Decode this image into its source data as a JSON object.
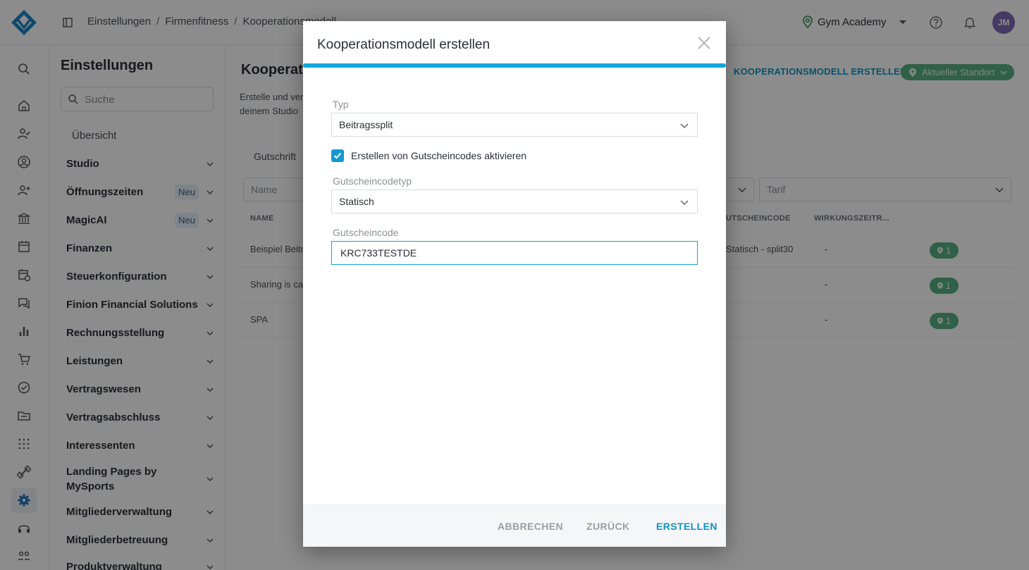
{
  "topbar": {
    "breadcrumb": [
      "Einstellungen",
      "Firmenfitness",
      "Kooperationsmodell"
    ],
    "breadcrumb_sep": "/",
    "studio": "Gym Academy",
    "avatar_initials": "JM"
  },
  "rail": {
    "icons": [
      "search-icon",
      "home-icon",
      "user-check-icon",
      "user-circle-icon",
      "user-add-icon",
      "bank-icon",
      "calendar-icon",
      "calendar-clock-icon",
      "chat-icon",
      "bar-chart-icon",
      "cart-icon",
      "check-circle-icon",
      "folder-icon",
      "dots-grid-icon",
      "dumbbell-icon",
      "gear-icon",
      "headset-icon",
      "people-icon"
    ],
    "active": "gear-icon"
  },
  "settings": {
    "title": "Einstellungen",
    "search_placeholder": "Suche",
    "overview": "Übersicht",
    "items": [
      {
        "label": "Studio",
        "badge": ""
      },
      {
        "label": "Öffnungszeiten",
        "badge": "Neu"
      },
      {
        "label": "MagicAI",
        "badge": "Neu"
      },
      {
        "label": "Finanzen",
        "badge": ""
      },
      {
        "label": "Steuerkonfiguration",
        "badge": ""
      },
      {
        "label": "Finion Financial Solutions",
        "badge": ""
      },
      {
        "label": "Rechnungsstellung",
        "badge": ""
      },
      {
        "label": "Leistungen",
        "badge": ""
      },
      {
        "label": "Vertragswesen",
        "badge": ""
      },
      {
        "label": "Vertragsabschluss",
        "badge": ""
      },
      {
        "label": "Interessenten",
        "badge": ""
      },
      {
        "label": "Landing Pages by MySports",
        "badge": ""
      },
      {
        "label": "Mitgliederverwaltung",
        "badge": ""
      },
      {
        "label": "Mitgliederbetreuung",
        "badge": ""
      },
      {
        "label": "Produktverwaltung",
        "badge": ""
      }
    ]
  },
  "main": {
    "title": "Kooperat",
    "description": "Erstelle und ver\ndeinem Studio",
    "create_label": "KOOPERATIONSMODELL ERSTELLEN",
    "location_label": "Aktueller Standort",
    "tab": "Gutschrift",
    "filter_name_placeholder": "Name",
    "filter_tarif_placeholder": "Tarif",
    "columns": {
      "name": "NAME",
      "code": "UTSCHEINCODE",
      "period": "WIRKUNGSZEITR..."
    },
    "rows": [
      {
        "name": "Beispiel Beitr",
        "code": "Statisch - split30",
        "period": "-",
        "locations": "1"
      },
      {
        "name": "Sharing is ca",
        "code": "",
        "period": "-",
        "locations": "1"
      },
      {
        "name": "SPA",
        "code": "",
        "period": "-",
        "locations": "1"
      }
    ]
  },
  "modal": {
    "title": "Kooperationsmodell erstellen",
    "type_label": "Typ",
    "type_value": "Beitragssplit",
    "checkbox_label": "Erstellen von Gutscheincodes aktivieren",
    "checkbox_checked": true,
    "codetype_label": "Gutscheincodetyp",
    "codetype_value": "Statisch",
    "code_label": "Gutscheincode",
    "code_value": "KRC733TESTDE",
    "buttons": {
      "cancel": "ABBRECHEN",
      "back": "ZURÜCK",
      "create": "ERSTELLEN"
    }
  },
  "colors": {
    "accent": "#1193c2",
    "progress": "#10a6da",
    "location_green": "#58b082",
    "avatar": "#7e6bb4"
  }
}
